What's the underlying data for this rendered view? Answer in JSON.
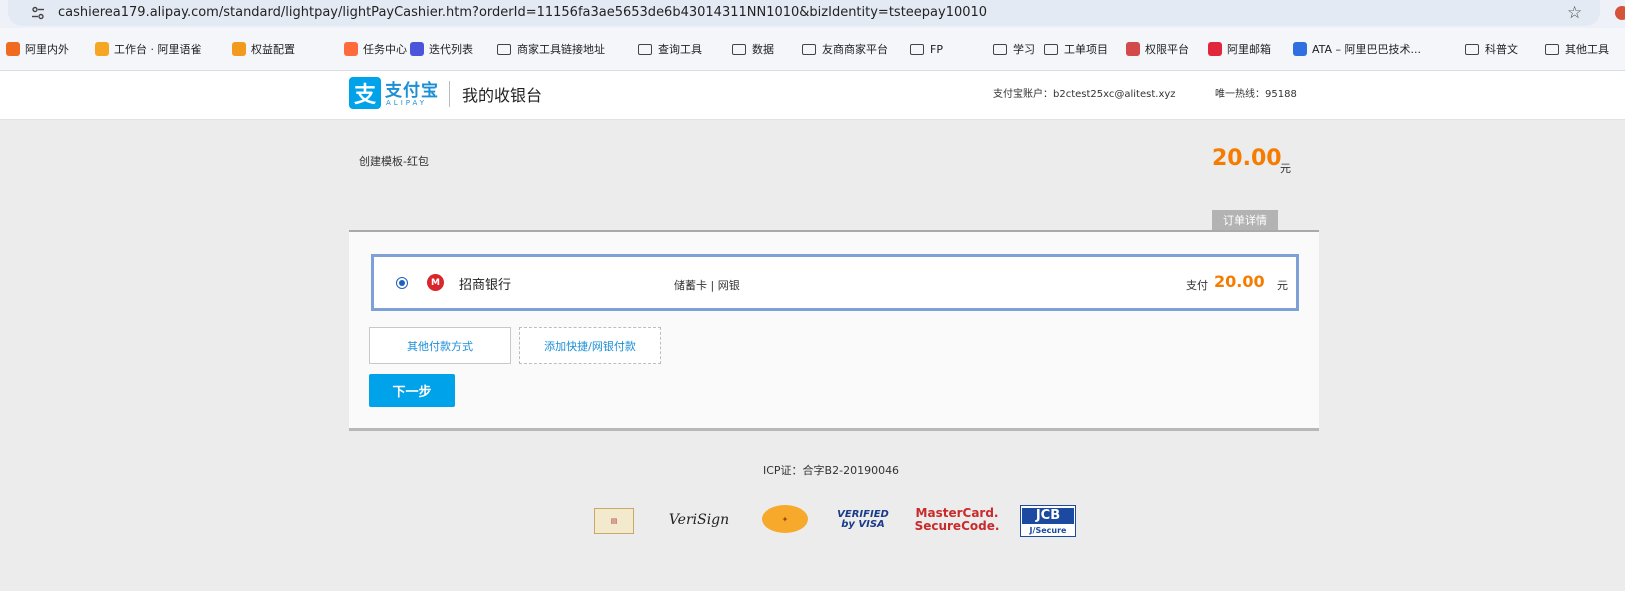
{
  "browser": {
    "url": "cashierea179.alipay.com/standard/lightpay/lightPayCashier.htm?orderId=11156fa3ae5653de6b43014311NN1010&bizIdentity=tsteepay10010",
    "bookmarks": [
      {
        "label": "阿里内外",
        "icon": "alibaba-intranet-icon",
        "color": "#f06b1f"
      },
      {
        "label": "工作台 · 阿里语雀",
        "icon": "yuque-icon",
        "color": "#f5a623"
      },
      {
        "label": "权益配置",
        "icon": "config-icon",
        "color": "#f29a1e"
      },
      {
        "label": "任务中心",
        "icon": "task-icon",
        "color": "#ff6a3d"
      },
      {
        "label": "迭代列表",
        "icon": "iteration-icon",
        "color": "#4a55d9"
      },
      {
        "label": "商家工具链接地址",
        "icon": "folder-icon"
      },
      {
        "label": "查询工具",
        "icon": "folder-icon"
      },
      {
        "label": "数据",
        "icon": "folder-icon"
      },
      {
        "label": "友商商家平台",
        "icon": "folder-icon"
      },
      {
        "label": "FP",
        "icon": "folder-icon"
      },
      {
        "label": "学习",
        "icon": "folder-icon"
      },
      {
        "label": "工单项目",
        "icon": "folder-icon"
      },
      {
        "label": "权限平台",
        "icon": "permission-icon",
        "color": "#d24a4a"
      },
      {
        "label": "阿里邮箱",
        "icon": "mail-icon",
        "color": "#e0283c"
      },
      {
        "label": "ATA – 阿里巴巴技术...",
        "icon": "ata-icon",
        "color": "#2f6fe0"
      },
      {
        "label": "科普文",
        "icon": "folder-icon"
      },
      {
        "label": "其他工具",
        "icon": "folder-icon"
      }
    ]
  },
  "header": {
    "logo_char": "支",
    "logo_name": "支付宝",
    "logo_sub": "ALIPAY",
    "title": "我的收银台",
    "account": "支付宝账户：b2ctest25xc@alitest.xyz",
    "hotline": "唯一热线：95188"
  },
  "order": {
    "name": "创建模板-红包",
    "amount": "20.00",
    "unit": "元",
    "detail_label": "订单详情"
  },
  "payment": {
    "bank_icon_char": "M",
    "bank_name": "招商银行",
    "card_type": "储蓄卡 | 网银",
    "pay_label": "支付",
    "pay_amount": "20.00",
    "pay_unit": "元",
    "other_methods": "其他付款方式",
    "add_card": "添加快捷/网银付款",
    "next": "下一步"
  },
  "footer": {
    "icp": "ICP证：合字B2-20190046",
    "verisign": "VeriSign",
    "visa_top": "VERIFIED",
    "visa_bottom": "by VISA",
    "mc_top": "MasterCard.",
    "mc_bottom": "SecureCode.",
    "jcb_top": "JCB",
    "jcb_bottom": "J/Secure"
  },
  "colors": {
    "brand": "#00a2ea",
    "amount": "#f57c00",
    "selected_border": "#7fa0d6"
  }
}
